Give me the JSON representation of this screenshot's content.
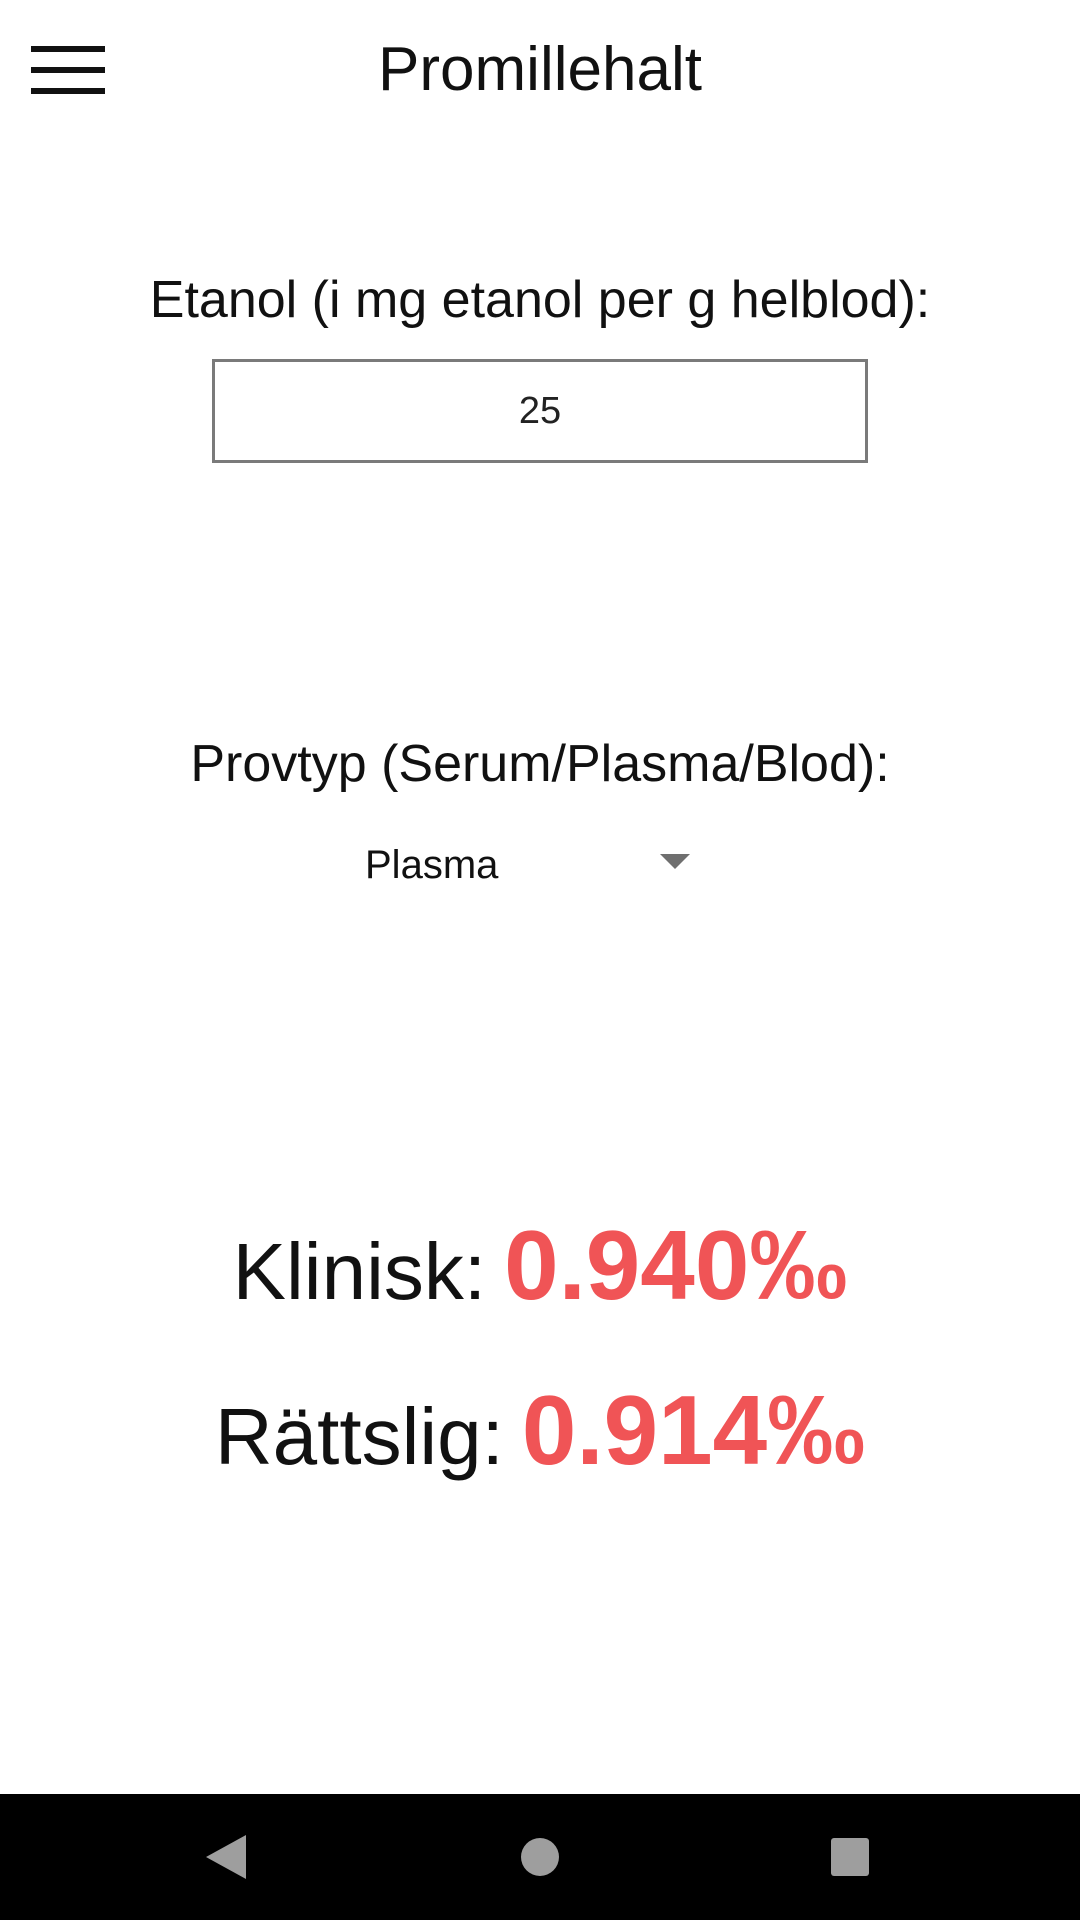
{
  "app_bar": {
    "title": "Promillehalt",
    "menu_icon": "hamburger-menu-icon"
  },
  "etanol": {
    "label": "Etanol (i mg etanol per g helblod):",
    "value": "25"
  },
  "provtyp": {
    "label": "Provtyp (Serum/Plasma/Blod):",
    "selected": "Plasma",
    "dropdown_icon": "dropdown-arrow-icon"
  },
  "results": {
    "klinisk_label": "Klinisk:",
    "klinisk_value": "0.940‰",
    "rattslig_label": "Rättslig:",
    "rattslig_value": "0.914‰"
  },
  "nav_bar": {
    "back_icon": "back-triangle-icon",
    "home_icon": "home-circle-icon",
    "recents_icon": "recents-square-icon"
  },
  "colors": {
    "accent": "#f05456",
    "text": "#111111",
    "nav_background": "#000000",
    "nav_icon": "#9e9e9e"
  }
}
